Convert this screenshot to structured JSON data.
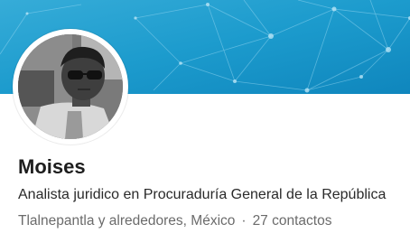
{
  "profile": {
    "name": "Moises",
    "headline": "Analista juridico en Procuraduría General de la República",
    "location": "Tlalnepantla y alrededores, México",
    "separator": "·",
    "connections": "27 contactos"
  },
  "banner": {
    "background_color": "#1a9bd0",
    "pattern": "network-constellation"
  },
  "avatar": {
    "style": "grayscale photo"
  },
  "colors": {
    "name": "#1d1d1d",
    "headline": "#2a2a2a",
    "meta": "#6b6b6b"
  }
}
